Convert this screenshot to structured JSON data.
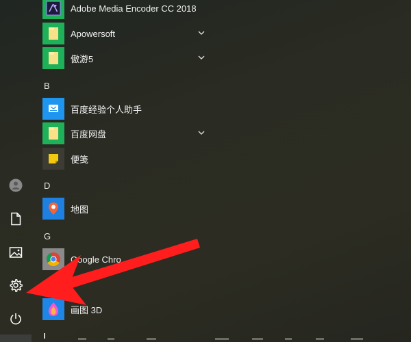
{
  "start_menu": {
    "apps": [
      {
        "label": "Adobe Media Encoder CC 2018",
        "icon": "adobe-media-encoder-icon",
        "expandable": false
      },
      {
        "label": "Apowersoft",
        "icon": "folder-icon",
        "expandable": true
      },
      {
        "label": "傲游5",
        "icon": "folder-icon",
        "expandable": true
      },
      {
        "label": "百度经验个人助手",
        "icon": "baidu-jingyan-icon",
        "expandable": false
      },
      {
        "label": "百度网盘",
        "icon": "folder-icon",
        "expandable": true
      },
      {
        "label": "便笺",
        "icon": "sticky-notes-icon",
        "expandable": false
      },
      {
        "label": "地图",
        "icon": "maps-icon",
        "expandable": false
      },
      {
        "label": "Google Chro",
        "icon": "chrome-icon",
        "expandable": false
      },
      {
        "label": "画图 3D",
        "icon": "paint-3d-icon",
        "expandable": false
      }
    ],
    "sections": {
      "b": "B",
      "d": "D",
      "g": "G",
      "h": "H"
    },
    "rail": [
      "user-icon",
      "documents-icon",
      "pictures-icon",
      "settings-icon",
      "power-icon"
    ],
    "colors": {
      "tile_green": "#1fb05a",
      "folder_yellow": "#f7e28a",
      "tile_blue": "#1e96f0",
      "arrow_red": "#ff1d1d"
    }
  }
}
